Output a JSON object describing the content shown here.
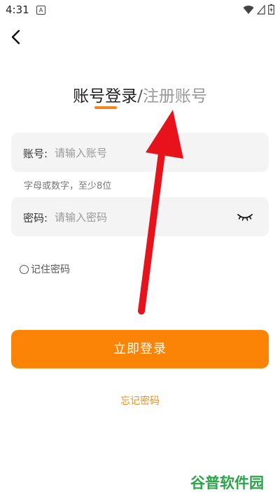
{
  "status_bar": {
    "time": "4:31",
    "app_icon_letter": "A"
  },
  "header": {
    "title_login": "账号登录",
    "title_separator": "/",
    "title_register": "注册账号"
  },
  "form": {
    "account_label": "账号:",
    "account_placeholder": "请输入账号",
    "account_hint": "字母或数字，至少8位",
    "password_label": "密码:",
    "password_placeholder": "请输入密码",
    "remember_label": "记住密码"
  },
  "actions": {
    "login_label": "立即登录",
    "forgot_label": "忘记密码"
  },
  "watermark": {
    "text": "谷普软件园"
  },
  "colors": {
    "accent": "#fb8406",
    "underline": "#f5851f",
    "annotation_arrow": "#e8121b",
    "watermark": "#2aa54a"
  },
  "icons": [
    "back-arrow-icon",
    "wifi-icon",
    "signal-icon",
    "battery-icon",
    "eye-closed-icon",
    "radio-unchecked-icon"
  ]
}
